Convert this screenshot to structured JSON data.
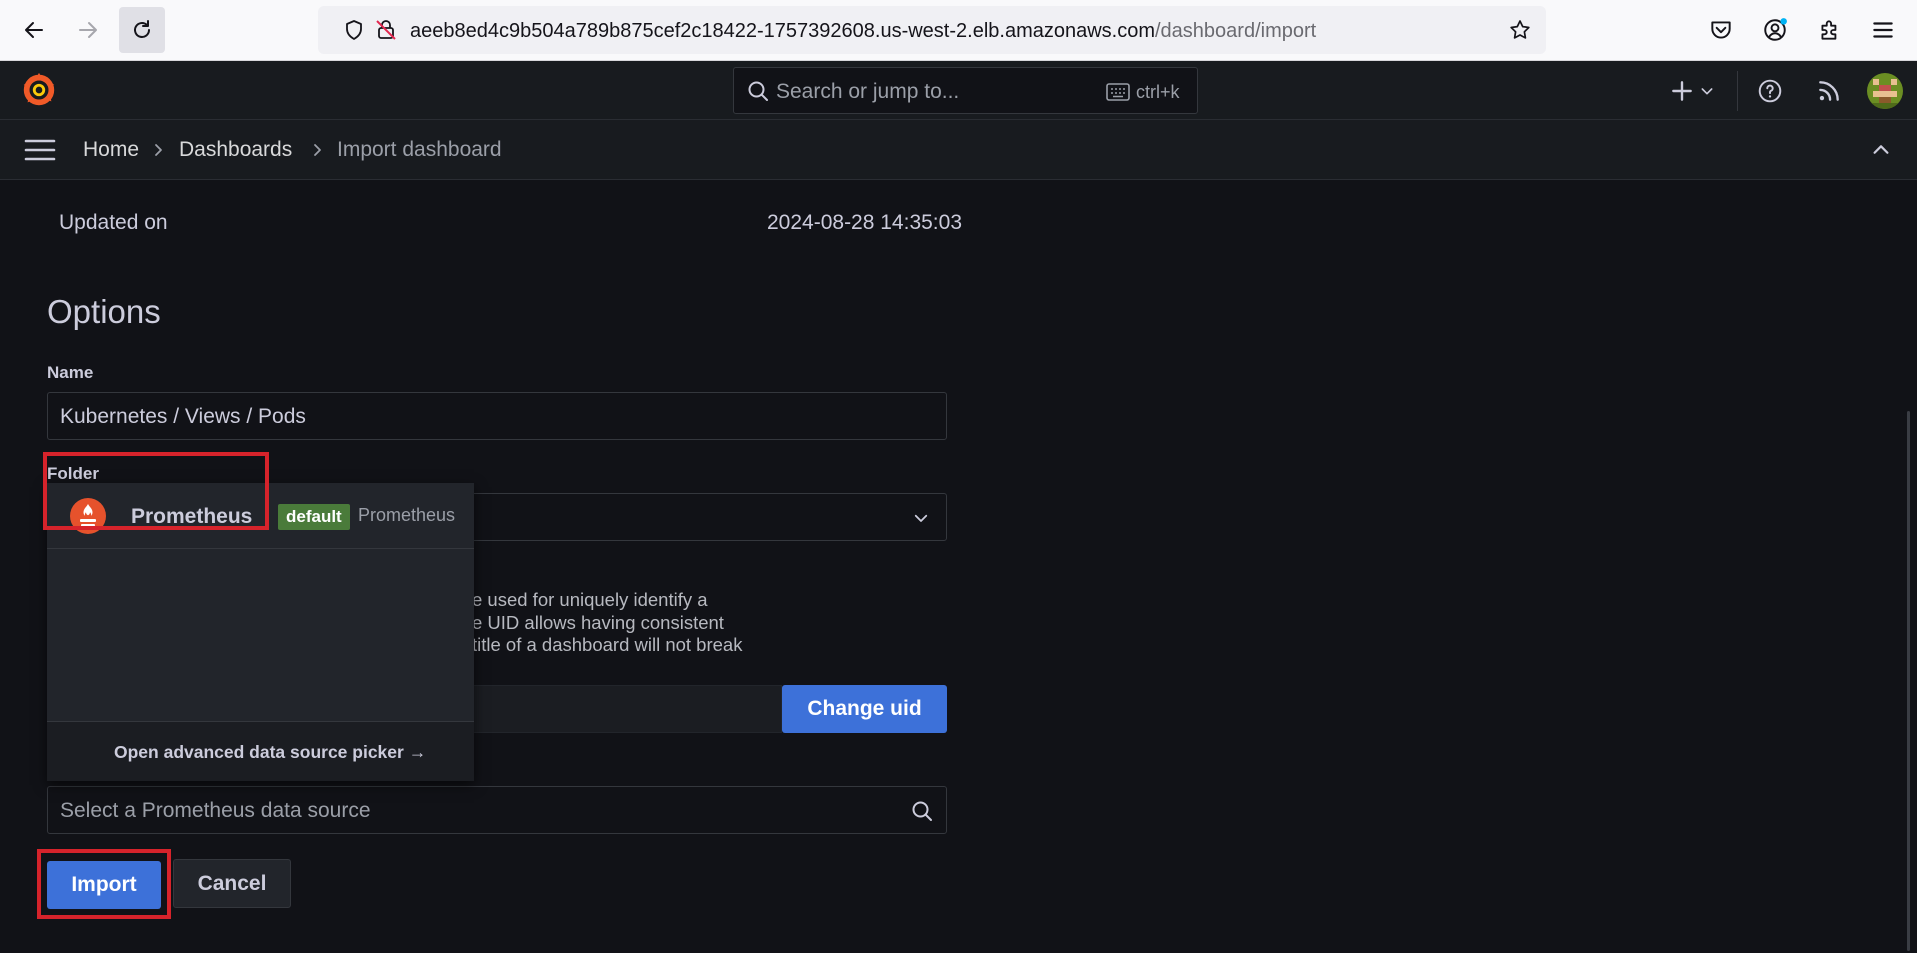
{
  "browser": {
    "url_main": "aeeb8ed4c9b504a789b875cef2c18422-1757392608.us-west-2.elb.amazonaws.com",
    "url_path": "/dashboard/import"
  },
  "topbar": {
    "search_placeholder": "Search or jump to...",
    "shortcut": "ctrl+k"
  },
  "breadcrumb": {
    "items": [
      "Home",
      "Dashboards",
      "Import dashboard"
    ]
  },
  "details": {
    "updated_label": "Updated on",
    "updated_value": "2024-08-28 14:35:03"
  },
  "options": {
    "title": "Options",
    "name_label": "Name",
    "name_value": "Kubernetes / Views / Pods",
    "folder_label": "Folder",
    "uid_desc_lines": [
      "e used for uniquely identify a",
      "e UID allows having consistent",
      "title of a dashboard will not break"
    ],
    "change_uid_label": "Change uid",
    "ds_placeholder": "Select a Prometheus data source",
    "import_label": "Import",
    "cancel_label": "Cancel"
  },
  "datasource_picker": {
    "option_name": "Prometheus",
    "badge": "default",
    "option_type": "Prometheus",
    "advanced_link": "Open advanced data source picker →"
  },
  "colors": {
    "primary": "#3d71d9",
    "highlight": "#d6232b",
    "badge": "#4a7b3a",
    "grafana_orange": "#f05a28"
  }
}
